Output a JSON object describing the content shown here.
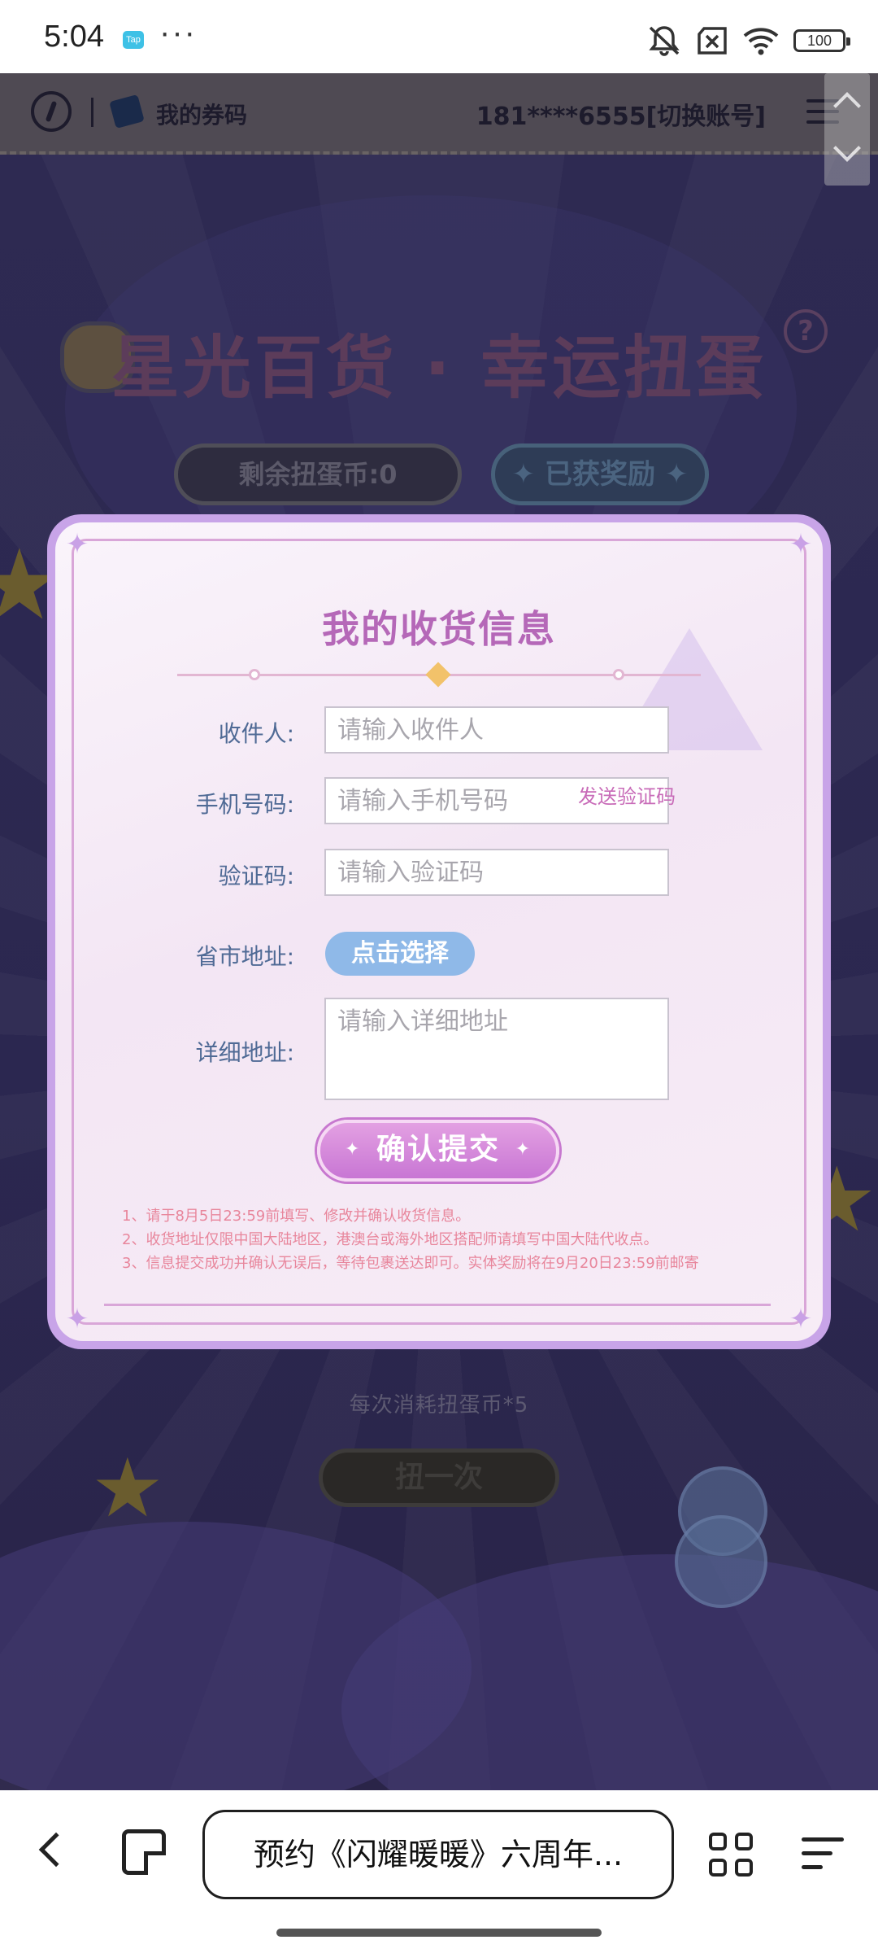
{
  "status_bar": {
    "time": "5:04",
    "notification_icon_text": "Tap",
    "more_indicator": "···",
    "battery": "100"
  },
  "site_header": {
    "coupon_label": "我的券码",
    "account": "181****6555[切换账号]"
  },
  "game": {
    "title": "星光百货 · 幸运扭蛋",
    "help_mark": "?",
    "coins_remaining": "剩余扭蛋币:0",
    "rewards_button": "✦ 已获奖励 ✦",
    "cost_text": "每次消耗扭蛋币*5",
    "spin_button": "扭一次"
  },
  "modal": {
    "title": "我的收货信息",
    "recipient_label": "收件人:",
    "recipient_placeholder": "请输入收件人",
    "phone_label": "手机号码:",
    "phone_placeholder": "请输入手机号码",
    "send_code": "发送验证码",
    "code_label": "验证码:",
    "code_placeholder": "请输入验证码",
    "region_label": "省市地址:",
    "region_button": "点击选择",
    "address_label": "详细地址:",
    "address_placeholder": "请输入详细地址",
    "submit": "确认提交",
    "notes": [
      "1、请于8月5日23:59前填写、修改并确认收货信息。",
      "2、收货地址仅限中国大陆地区，港澳台或海外地区搭配师请填写中国大陆代收点。",
      "3、信息提交成功并确认无误后，等待包裹送达即可。实体奖励将在9月20日23:59前邮寄"
    ]
  },
  "browser": {
    "url_title": "预约《闪耀暖暖》六周年..."
  }
}
